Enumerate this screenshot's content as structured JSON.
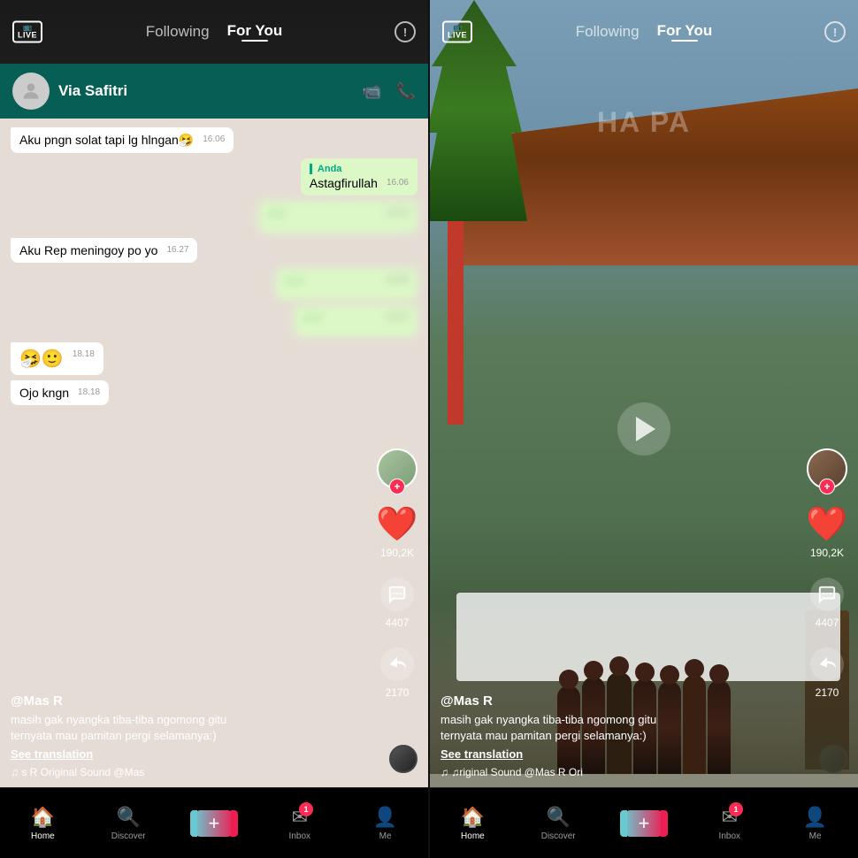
{
  "left_panel": {
    "top_bar": {
      "live_label": "LIVE",
      "following_label": "Following",
      "for_you_label": "For You",
      "info_symbol": "!"
    },
    "chat": {
      "contact_name": "Via Safitri",
      "msg1": "Aku pngn solat tapi lg hlngan🤧",
      "msg1_time": "16.06",
      "msg2_label": "Anda",
      "msg2": "Astagfirullah",
      "msg2_time": "16.06",
      "msg3_time": "16.20",
      "msg4": "Aku Rep meningoy po yo",
      "msg4_time": "16.27",
      "msg5_time": "16.36",
      "msg6_time": "16.37"
    },
    "action_buttons": {
      "heart_count": "190,2K",
      "comment_count": "4407",
      "share_count": "2170"
    },
    "video_info": {
      "username": "@Mas R",
      "caption_line1": "masih gak nyangka tiba-tiba ngomong gitu",
      "caption_line2": "ternyata mau pamitan pergi selamanya:)",
      "see_translation": "See translation",
      "sound_text": "♫ s R Original Sound   @Mas"
    },
    "tab_bar": {
      "home_label": "Home",
      "discover_label": "Discover",
      "plus_symbol": "+",
      "inbox_label": "Inbox",
      "inbox_badge": "1",
      "me_label": "Me"
    }
  },
  "right_panel": {
    "top_bar": {
      "live_label": "LIVE",
      "following_label": "Following",
      "for_you_label": "For You",
      "info_symbol": "!"
    },
    "watermark": "HA  PA",
    "action_buttons": {
      "heart_count": "190,2K",
      "comment_count": "4407",
      "share_count": "2170"
    },
    "video_info": {
      "username": "@Mas R",
      "caption_line1": "masih gak nyangka tiba-tiba ngomong gitu",
      "caption_line2": "ternyata mau pamitan pergi selamanya:)",
      "see_translation": "See translation",
      "sound_text": "♫ ♫riginal Sound   @Mas R Ori"
    },
    "tab_bar": {
      "home_label": "Home",
      "discover_label": "Discover",
      "plus_symbol": "+",
      "inbox_label": "Inbox",
      "inbox_badge": "1",
      "me_label": "Me"
    }
  }
}
